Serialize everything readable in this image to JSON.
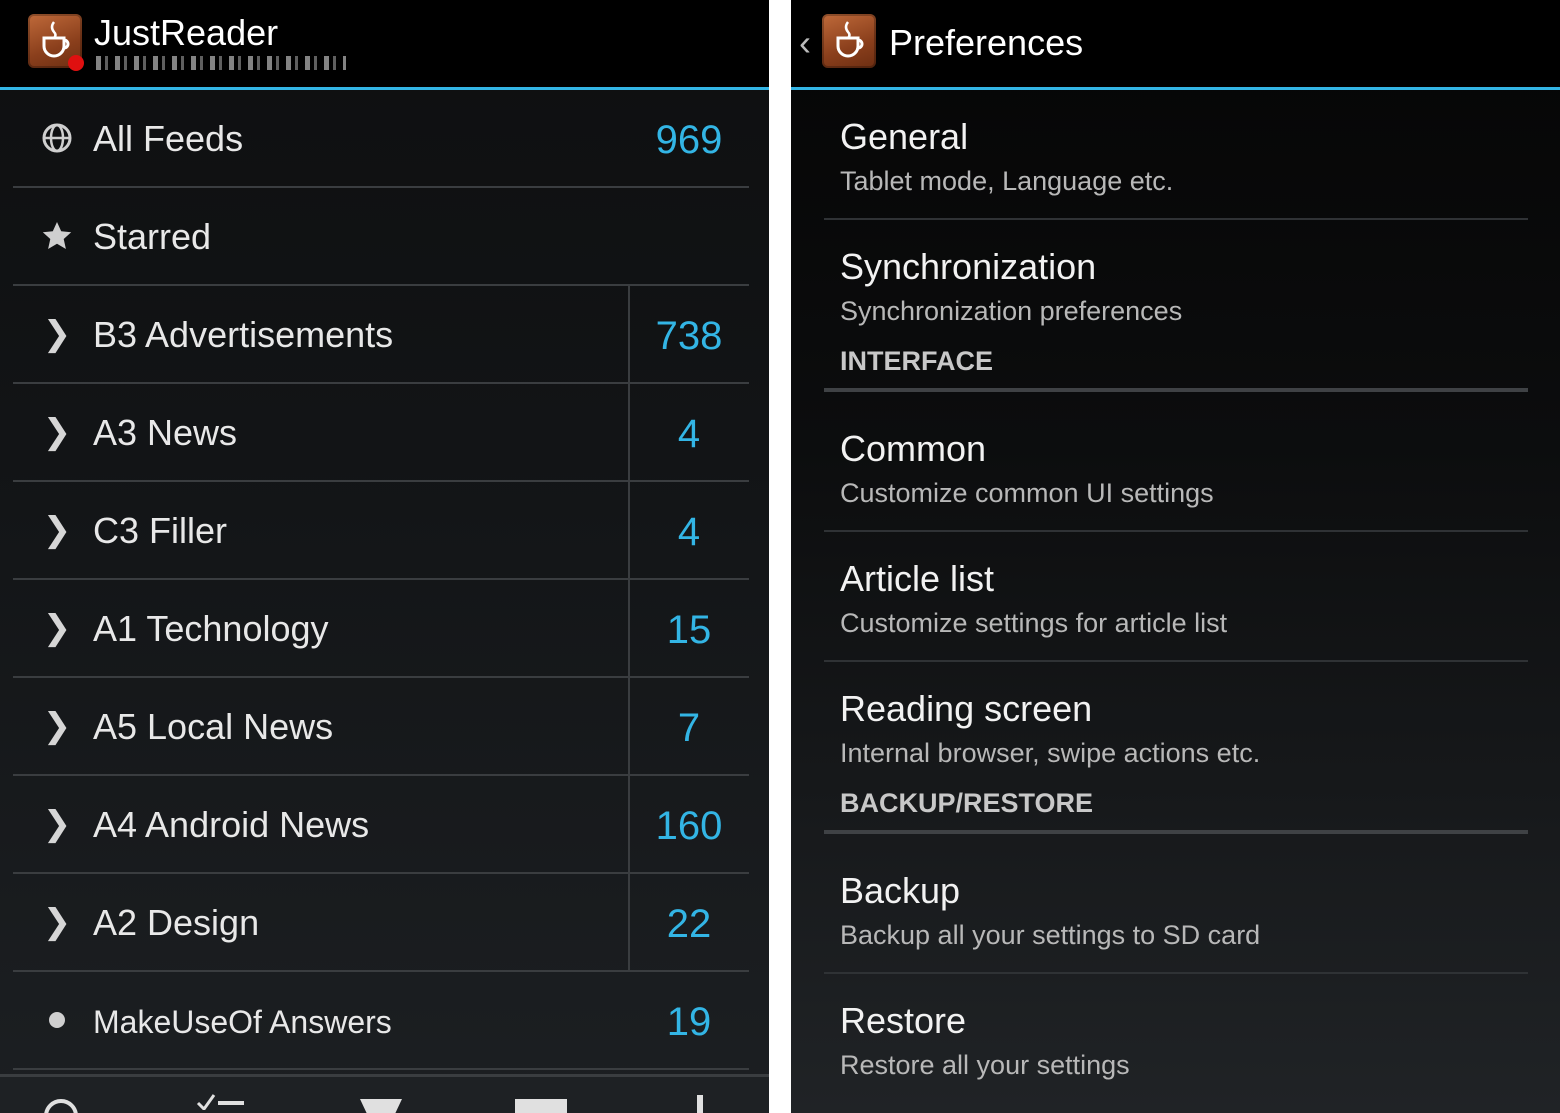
{
  "colors": {
    "accent": "#33b5e5",
    "background": "#121416",
    "badge": "#e01010"
  },
  "left": {
    "app_title": "JustReader",
    "feeds": [
      {
        "icon": "globe-icon",
        "label": "All Feeds",
        "count": "969",
        "divider": false
      },
      {
        "icon": "star-icon",
        "label": "Starred",
        "count": "",
        "divider": false
      },
      {
        "icon": "chevron-right-icon",
        "label": "B3 Advertisements",
        "count": "738",
        "divider": true
      },
      {
        "icon": "chevron-right-icon",
        "label": "A3 News",
        "count": "4",
        "divider": true
      },
      {
        "icon": "chevron-right-icon",
        "label": "C3 Filler",
        "count": "4",
        "divider": true
      },
      {
        "icon": "chevron-right-icon",
        "label": "A1 Technology",
        "count": "15",
        "divider": true
      },
      {
        "icon": "chevron-right-icon",
        "label": "A5 Local News",
        "count": "7",
        "divider": true
      },
      {
        "icon": "chevron-right-icon",
        "label": "A4 Android News",
        "count": "160",
        "divider": true
      },
      {
        "icon": "chevron-right-icon",
        "label": "A2 Design",
        "count": "22",
        "divider": true
      },
      {
        "icon": "dot-icon",
        "label": "MakeUseOf Answers",
        "count": "19",
        "divider": false
      }
    ],
    "bottom_icons": [
      "refresh-icon",
      "mark-read-icon",
      "filter-icon",
      "view-icon",
      "more-icon"
    ]
  },
  "right": {
    "title": "Preferences",
    "items": [
      {
        "kind": "pref",
        "title": "General",
        "summary": "Tablet mode, Language etc."
      },
      {
        "kind": "pref",
        "title": "Synchronization",
        "summary": "Synchronization preferences",
        "noborder": true
      },
      {
        "kind": "category",
        "title": "INTERFACE"
      },
      {
        "kind": "pref",
        "title": "Common",
        "summary": "Customize common UI settings"
      },
      {
        "kind": "pref",
        "title": "Article list",
        "summary": "Customize settings for article list"
      },
      {
        "kind": "pref",
        "title": "Reading screen",
        "summary": "Internal browser, swipe actions etc.",
        "noborder": true
      },
      {
        "kind": "category",
        "title": "BACKUP/RESTORE"
      },
      {
        "kind": "pref",
        "title": "Backup",
        "summary": "Backup all your settings to SD card"
      },
      {
        "kind": "pref",
        "title": "Restore",
        "summary": "Restore all your settings",
        "noborder": true
      }
    ]
  }
}
